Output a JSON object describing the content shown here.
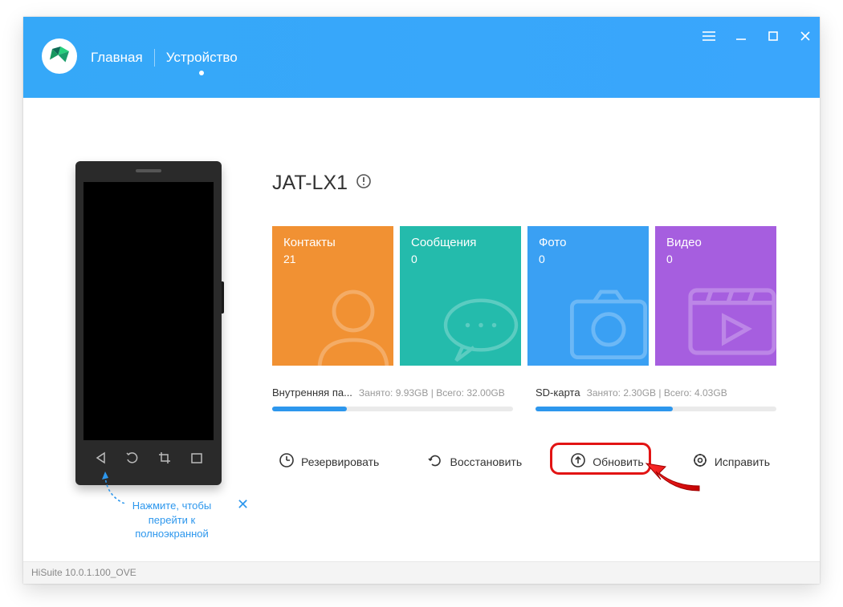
{
  "nav": {
    "home": "Главная",
    "device": "Устройство"
  },
  "device_name": "JAT-LX1",
  "tiles": {
    "contacts": {
      "label": "Контакты",
      "count": "21"
    },
    "messages": {
      "label": "Сообщения",
      "count": "0"
    },
    "photos": {
      "label": "Фото",
      "count": "0"
    },
    "videos": {
      "label": "Видео",
      "count": "0"
    }
  },
  "storage": {
    "internal": {
      "label": "Внутренняя па...",
      "used_lbl": "Занято:",
      "used": "9.93GB",
      "total_lbl": "Всего:",
      "total": "32.00GB",
      "percent": 31
    },
    "sd": {
      "label": "SD-карта",
      "used_lbl": "Занято:",
      "used": "2.30GB",
      "total_lbl": "Всего:",
      "total": "4.03GB",
      "percent": 57
    }
  },
  "actions": {
    "backup": "Резервировать",
    "restore": "Восстановить",
    "update": "Обновить",
    "fix": "Исправить"
  },
  "hint": "Нажмите, чтобы перейти к полноэкранной",
  "status": "HiSuite 10.0.1.100_OVE"
}
